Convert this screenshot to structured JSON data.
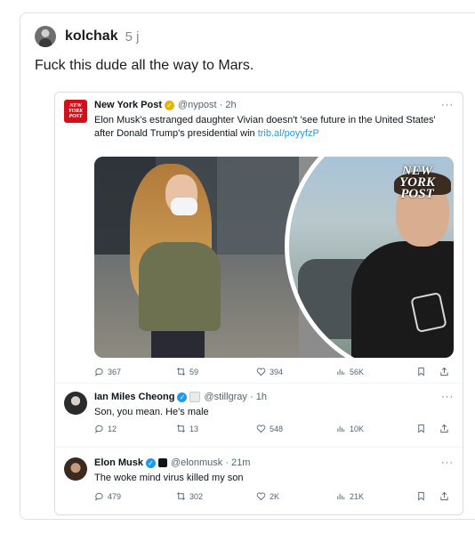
{
  "post": {
    "username": "kolchak",
    "age": "5 j",
    "text": "Fuck this dude all the way to Mars."
  },
  "tweets": [
    {
      "name": "New York Post",
      "handle": "@nypost · 2h",
      "logo_text": "NEW YORK POST",
      "text": "Elon Musk's estranged daughter Vivian doesn't 'see future in the United States' after Donald Trump's presidential win",
      "link": "trib.al/poyyfzP",
      "media_watermark": "NEW YORK POST",
      "stats": {
        "replies": "367",
        "retweets": "59",
        "likes": "394",
        "views": "56K"
      }
    },
    {
      "name": "Ian Miles Cheong",
      "handle": "@stillgray · 1h",
      "text": "Son, you mean. He's male",
      "stats": {
        "replies": "12",
        "retweets": "13",
        "likes": "548",
        "views": "10K"
      }
    },
    {
      "name": "Elon Musk",
      "handle": "@elonmusk · 21m",
      "text": "The woke mind virus killed my son",
      "stats": {
        "replies": "479",
        "retweets": "302",
        "likes": "2K",
        "views": "21K"
      }
    }
  ],
  "more_label": "···",
  "colors": {
    "link": "#1d9bf0",
    "nyp_red": "#d1111a",
    "verified_gold": "#e8b400",
    "verified_blue": "#1d9bf0",
    "muted": "#536471"
  }
}
